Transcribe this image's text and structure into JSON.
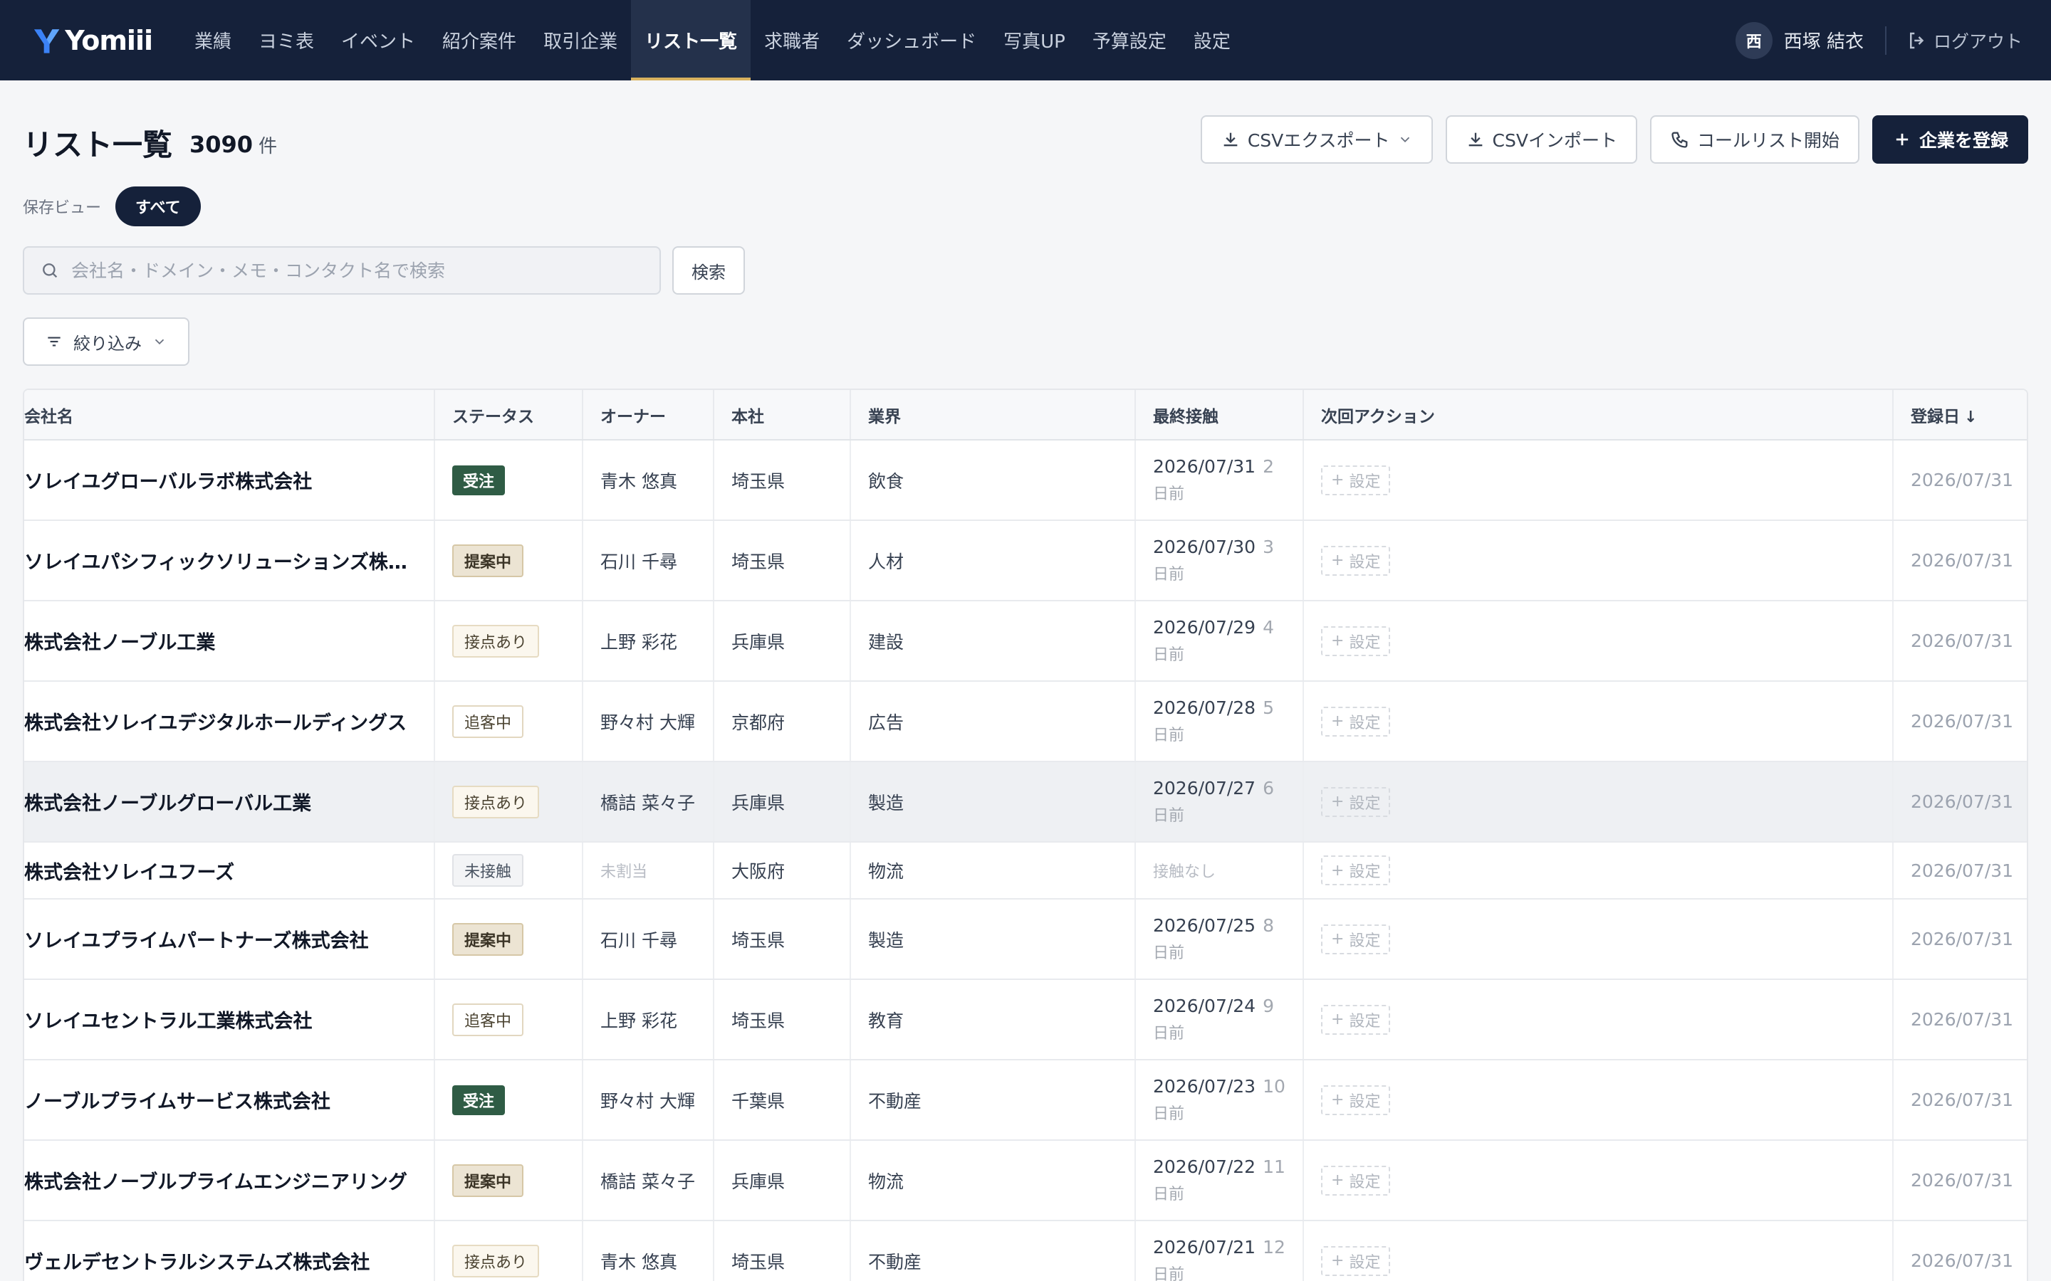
{
  "app": {
    "name": "Yomiii"
  },
  "nav": {
    "items": [
      {
        "label": "業績"
      },
      {
        "label": "ヨミ表"
      },
      {
        "label": "イベント"
      },
      {
        "label": "紹介案件"
      },
      {
        "label": "取引企業"
      },
      {
        "label": "リスト一覧"
      },
      {
        "label": "求職者"
      },
      {
        "label": "ダッシュボード"
      },
      {
        "label": "写真UP"
      },
      {
        "label": "予算設定"
      },
      {
        "label": "設定"
      }
    ],
    "active": "リスト一覧",
    "user": {
      "initial": "西",
      "name": "西塚 結衣"
    },
    "logout_label": "ログアウト"
  },
  "header": {
    "title": "リスト一覧",
    "count": "3090",
    "count_unit": "件",
    "actions": {
      "csv_export": "CSVエクスポート",
      "csv_import": "CSVインポート",
      "call_list": "コールリスト開始",
      "register": "企業を登録"
    }
  },
  "views": {
    "label": "保存ビュー",
    "selected": "すべて"
  },
  "search": {
    "placeholder": "会社名・ドメイン・メモ・コンタクト名で検索",
    "value": "",
    "button": "検索"
  },
  "filter": {
    "label": "絞り込み"
  },
  "table": {
    "columns": [
      "会社名",
      "ステータス",
      "オーナー",
      "本社",
      "業界",
      "最終接触",
      "次回アクション",
      "登録日"
    ],
    "sort_indicator": "↓",
    "set_label": "設定",
    "days_ago_suffix": "日前",
    "rows": [
      {
        "company": "ソレイユグローバルラボ株式会社",
        "status": "受注",
        "status_type": "won",
        "owner": "青木 悠真",
        "hq": "埼玉県",
        "industry": "飲食",
        "last_contact": "2026/07/31",
        "days": "2",
        "days_suffix": "日前",
        "next": "設定",
        "registered": "2026/07/31"
      },
      {
        "company": "ソレイユパシフィックソリューションズ株…",
        "status": "提案中",
        "status_type": "proposal",
        "owner": "石川 千尋",
        "hq": "埼玉県",
        "industry": "人材",
        "last_contact": "2026/07/30",
        "days": "3",
        "days_suffix": "日前",
        "next": "設定",
        "registered": "2026/07/31"
      },
      {
        "company": "株式会社ノーブル工業",
        "status": "接点あり",
        "status_type": "contact",
        "owner": "上野 彩花",
        "hq": "兵庫県",
        "industry": "建設",
        "last_contact": "2026/07/29",
        "days": "4",
        "days_suffix": "日前",
        "next": "設定",
        "registered": "2026/07/31"
      },
      {
        "company": "株式会社ソレイユデジタルホールディングス",
        "status": "追客中",
        "status_type": "follow",
        "owner": "野々村 大輝",
        "hq": "京都府",
        "industry": "広告",
        "last_contact": "2026/07/28",
        "days": "5",
        "days_suffix": "日前",
        "next": "設定",
        "registered": "2026/07/31"
      },
      {
        "company": "株式会社ノーブルグローバル工業",
        "status": "接点あり",
        "status_type": "contact",
        "owner": "橋詰 菜々子",
        "hq": "兵庫県",
        "industry": "製造",
        "last_contact": "2026/07/27",
        "days": "6",
        "days_suffix": "日前",
        "next": "設定",
        "registered": "2026/07/31",
        "highlight": true
      },
      {
        "company": "株式会社ソレイユフーズ",
        "status": "未接触",
        "status_type": "none",
        "owner": "未割当",
        "owner_muted": true,
        "hq": "大阪府",
        "industry": "物流",
        "last_contact": "接触なし",
        "no_contact": true,
        "days": "",
        "days_suffix": "",
        "next": "設定",
        "registered": "2026/07/31"
      },
      {
        "company": "ソレイユプライムパートナーズ株式会社",
        "status": "提案中",
        "status_type": "proposal",
        "owner": "石川 千尋",
        "hq": "埼玉県",
        "industry": "製造",
        "last_contact": "2026/07/25",
        "days": "8",
        "days_suffix": "日前",
        "next": "設定",
        "registered": "2026/07/31"
      },
      {
        "company": "ソレイユセントラル工業株式会社",
        "status": "追客中",
        "status_type": "follow",
        "owner": "上野 彩花",
        "hq": "埼玉県",
        "industry": "教育",
        "last_contact": "2026/07/24",
        "days": "9",
        "days_suffix": "日前",
        "next": "設定",
        "registered": "2026/07/31"
      },
      {
        "company": "ノーブルプライムサービス株式会社",
        "status": "受注",
        "status_type": "won",
        "owner": "野々村 大輝",
        "hq": "千葉県",
        "industry": "不動産",
        "last_contact": "2026/07/23",
        "days": "10",
        "days_suffix": "日前",
        "next": "設定",
        "registered": "2026/07/31"
      },
      {
        "company": "株式会社ノーブルプライムエンジニアリング",
        "status": "提案中",
        "status_type": "proposal",
        "owner": "橋詰 菜々子",
        "hq": "兵庫県",
        "industry": "物流",
        "last_contact": "2026/07/22",
        "days": "11",
        "days_suffix": "日前",
        "next": "設定",
        "registered": "2026/07/31"
      },
      {
        "company": "ヴェルデセントラルシステムズ株式会社",
        "status": "接点あり",
        "status_type": "contact",
        "owner": "青木 悠真",
        "hq": "埼玉県",
        "industry": "不動産",
        "last_contact": "2026/07/21",
        "days": "12",
        "days_suffix": "日前",
        "next": "設定",
        "registered": "2026/07/31"
      }
    ]
  },
  "colors": {
    "nav_bg": "#15213a",
    "accent": "#d9b25f",
    "won": "#2f5c45"
  }
}
